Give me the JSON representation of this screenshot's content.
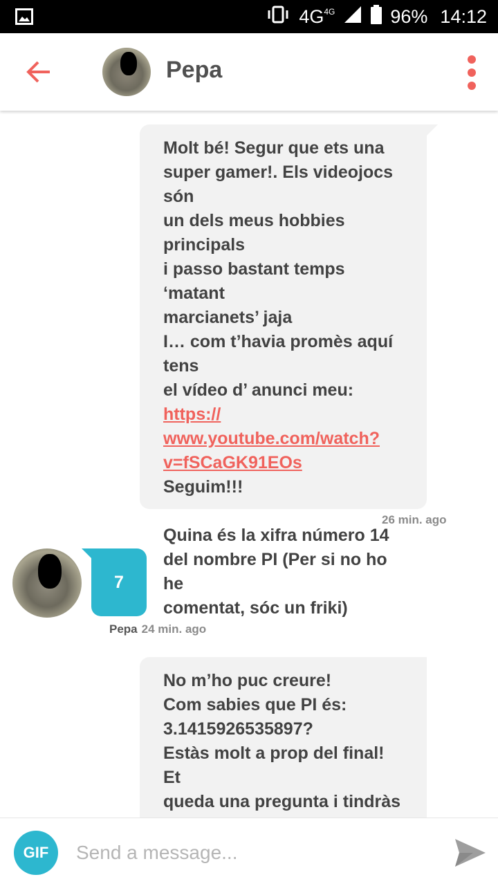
{
  "status_bar": {
    "network": "4G",
    "network_super": "4G",
    "battery": "96%",
    "time": "14:12"
  },
  "header": {
    "contact_name": "Pepa",
    "back_icon": "arrow-left-icon",
    "menu_icon": "more-vertical-icon"
  },
  "colors": {
    "accent": "#f0625c",
    "incoming_bubble": "#2db7cf",
    "outgoing_bubble": "#f2f2f2"
  },
  "messages": [
    {
      "direction": "outgoing",
      "text_before_link": "Molt bé! Segur que ets una\nsuper gamer!. Els videojocs són\nun dels meus hobbies principals\ni passo bastant temps ‘matant\nmarcianets’ jaja\nI… com t’havia promès aquí tens\nel vídeo d’ anunci meu: ",
      "link": "https://\nwww.youtube.com/watch?\nv=fSCaGK91EOs",
      "text_after_link": "\nSeguim!!!\n\nQuina és la xifra número 14\ndel nombre PI (Per si no ho he\ncomentat, sóc un friki)",
      "timestamp": "26 min. ago"
    },
    {
      "direction": "incoming",
      "sender": "Pepa",
      "text": "7",
      "timestamp": "24 min. ago"
    },
    {
      "direction": "outgoing",
      "text": "No m’ho puc creure!\nCom sabies que PI és:\n3.1415926535897?\nEstàs molt a prop del final! Et\nqueda una pregunta i tindràs\nl’inigualable honor de coneixem:"
    }
  ],
  "composer": {
    "gif_label": "GIF",
    "placeholder": "Send a message...",
    "send_icon": "send-icon"
  }
}
